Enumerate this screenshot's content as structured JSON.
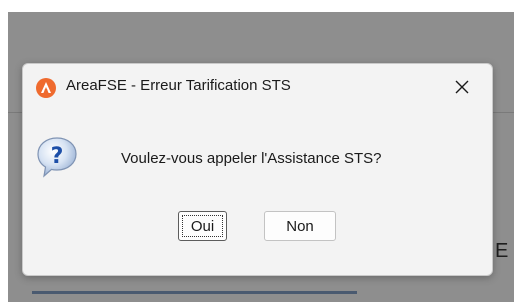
{
  "dialog": {
    "title": "AreaFSE - Erreur Tarification STS",
    "message": "Voulez-vous appeler l'Assistance STS?",
    "close_icon": "close-icon",
    "app_icon": "areafse-logo-icon",
    "question_icon": "question-icon",
    "buttons": {
      "yes_label": "Oui",
      "no_label": "Non"
    }
  },
  "background": {
    "partial_text": "E"
  },
  "colors": {
    "app_icon": "#ef6a2e",
    "dialog_bg": "#f3f3f3",
    "question_icon": "#2f6fc2"
  }
}
